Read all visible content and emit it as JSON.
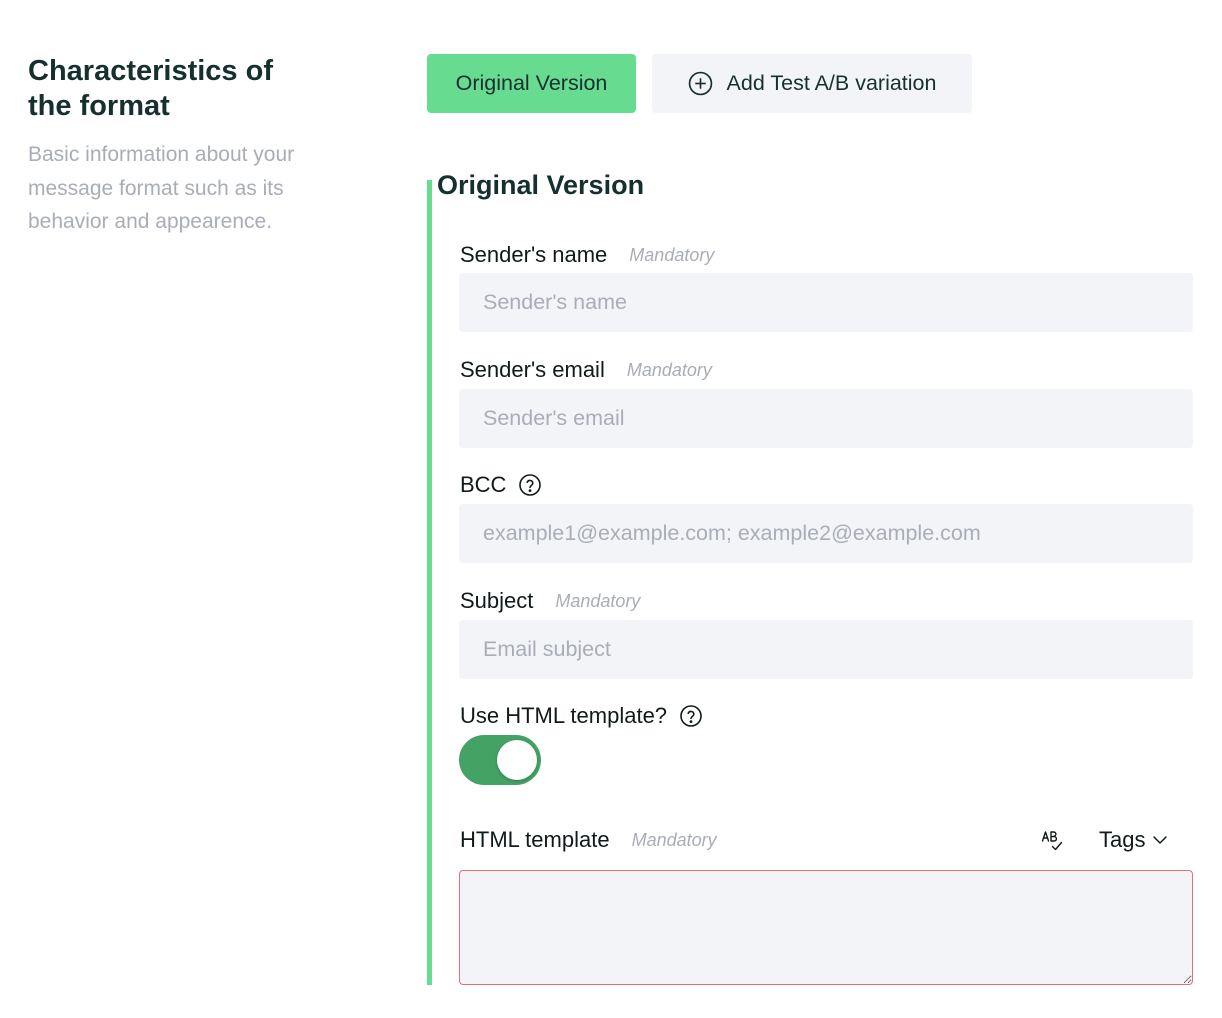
{
  "intro": {
    "title": "Characteristics of the format",
    "description": "Basic information about your message format such as its behavior and appearence."
  },
  "version_tabs": {
    "original_label": "Original Version",
    "add_label": "Add Test A/B variation"
  },
  "section": {
    "title": "Original Version",
    "mandatory_text": "Mandatory",
    "fields": {
      "sender_name": {
        "label": "Sender's name",
        "placeholder": "Sender's name",
        "value": ""
      },
      "sender_email": {
        "label": "Sender's email",
        "placeholder": "Sender's email",
        "value": ""
      },
      "bcc": {
        "label": "BCC",
        "placeholder": "example1@example.com; example2@example.com",
        "value": ""
      },
      "subject": {
        "label": "Subject",
        "placeholder": "Email subject",
        "value": ""
      },
      "use_html_template": {
        "label": "Use HTML template?",
        "checked": true
      },
      "html_template": {
        "label": "HTML template",
        "value": ""
      }
    },
    "tags_label": "Tags"
  },
  "colors": {
    "accent_green": "#67db8f",
    "toggle_on": "#45a265",
    "input_bg": "#f3f4f8",
    "error_border": "#e0707c",
    "heading": "#16302f",
    "muted": "#a9adb7"
  },
  "icons": {
    "add": "plus-circle-icon",
    "help": "question-circle-icon",
    "spellcheck": "spellcheck-icon",
    "dropdown": "chevron-down-icon"
  }
}
